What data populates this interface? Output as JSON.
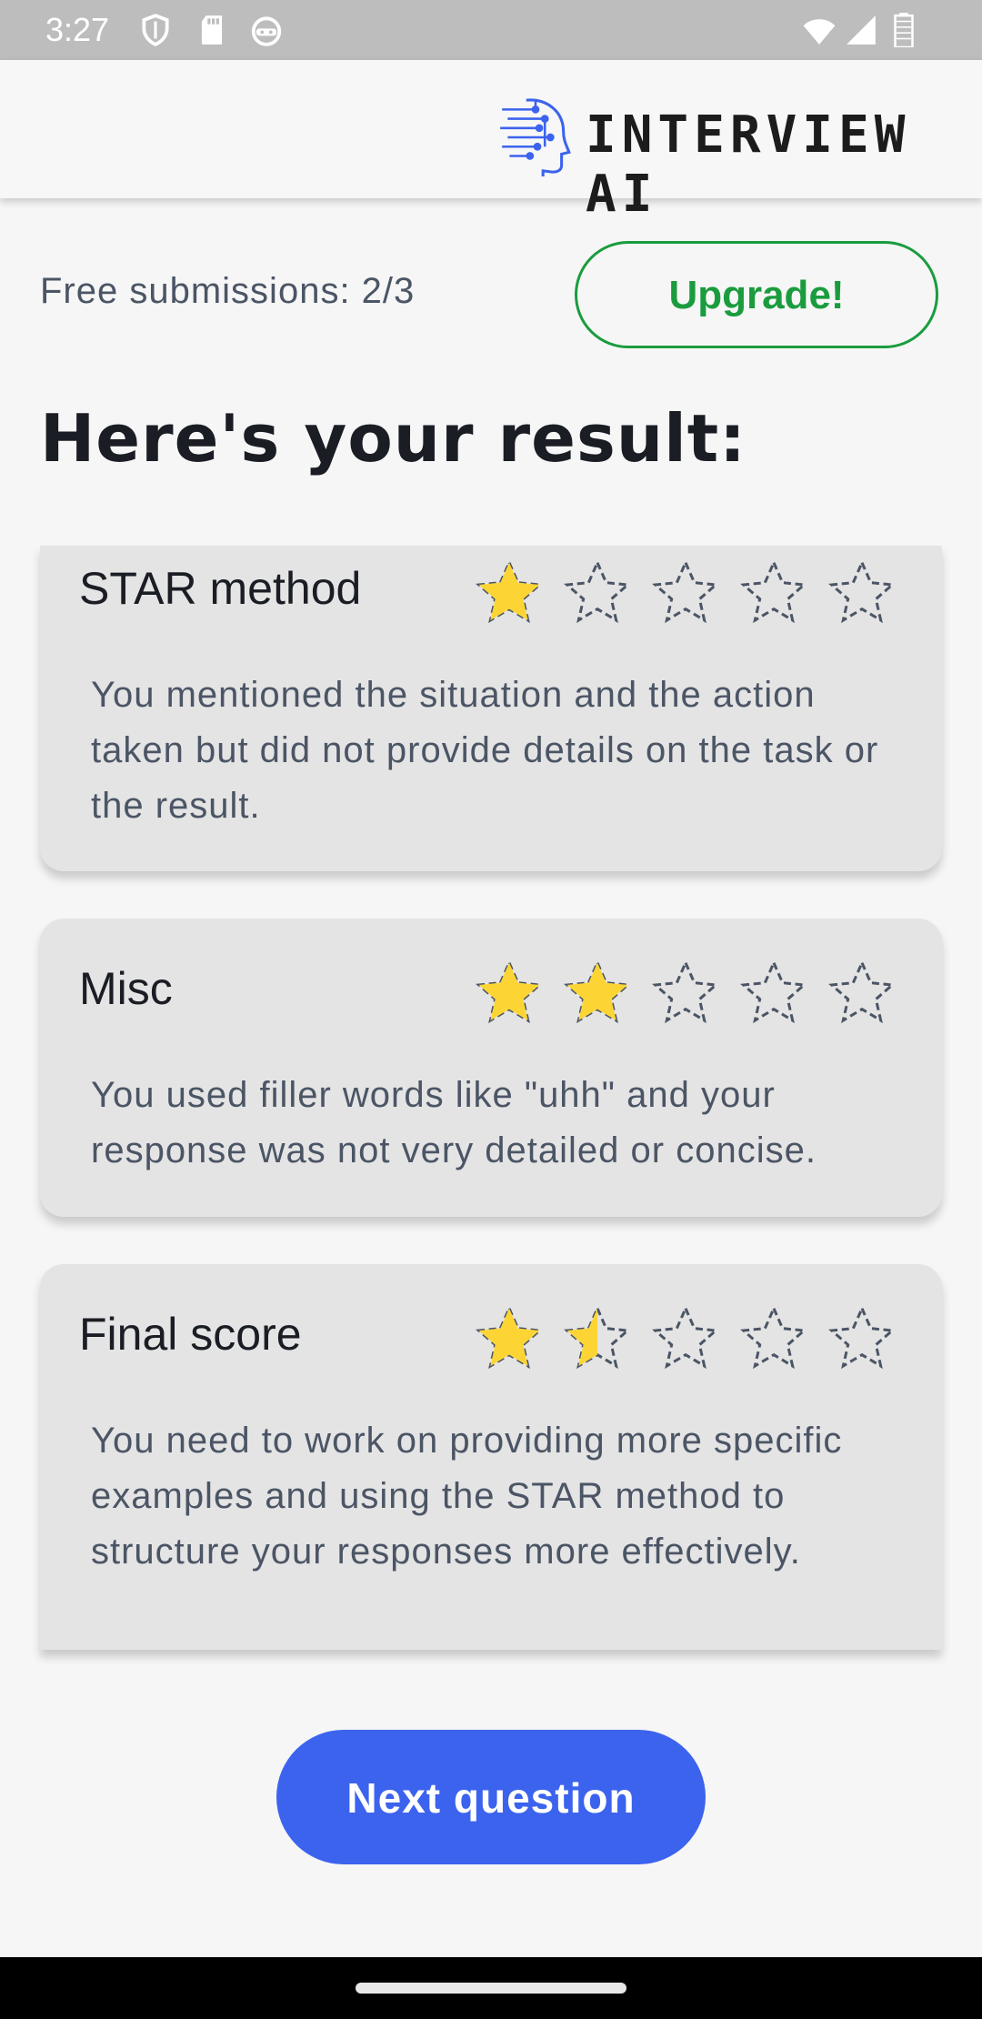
{
  "status_bar": {
    "time": "3:27",
    "left_icons": [
      "shield-icon",
      "sdcard-icon",
      "android-icon"
    ],
    "right_icons": [
      "wifi-icon",
      "signal-icon",
      "battery-icon"
    ]
  },
  "header": {
    "logo_text": "INTERVIEW AI",
    "logo_icon": "ai-head-icon",
    "logo_color": "#3c63ee"
  },
  "submissions": {
    "label": "Free submissions: 2/3",
    "upgrade_label": "Upgrade!",
    "upgrade_color": "#1a9c3e"
  },
  "result_title": "Here's your result:",
  "cards": [
    {
      "title": "STAR method",
      "rating": 1,
      "max": 5,
      "text": "You mentioned the situation and the action taken but did not provide details on the task or the result."
    },
    {
      "title": "Misc",
      "rating": 2,
      "max": 5,
      "text": "You used filler words like \"uhh\" and your response was not very detailed or concise."
    },
    {
      "title": "Final score",
      "rating": 1.5,
      "max": 5,
      "text": "You need to work on providing more specific examples and using the STAR method to structure your responses more effectively."
    }
  ],
  "next_button": {
    "label": "Next question",
    "color": "#3c63ee"
  },
  "star_fill_color": "#fcd535",
  "star_outline_color": "#4b5565"
}
